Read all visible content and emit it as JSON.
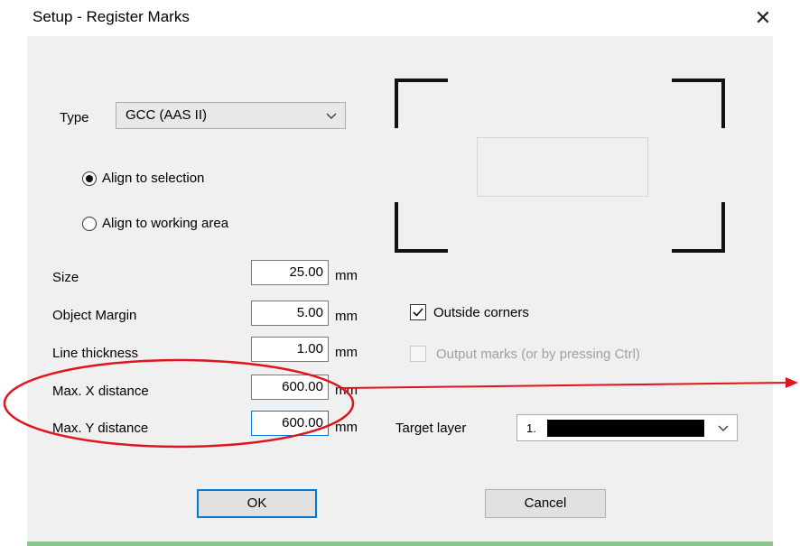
{
  "window": {
    "title": "Setup - Register Marks",
    "close_symbol": "✕"
  },
  "type_field": {
    "label": "Type",
    "value": "GCC (AAS II)"
  },
  "align": {
    "options": [
      {
        "label": "Align to selection",
        "checked": true
      },
      {
        "label": "Align to working area",
        "checked": false
      }
    ]
  },
  "fields": [
    {
      "label": "Size",
      "value": "25.00",
      "unit": "mm"
    },
    {
      "label": "Object Margin",
      "value": "5.00",
      "unit": "mm"
    },
    {
      "label": "Line thickness",
      "value": "1.00",
      "unit": "mm"
    },
    {
      "label": "Max. X distance",
      "value": "600.00",
      "unit": "mm"
    },
    {
      "label": "Max. Y distance",
      "value": "600.00",
      "unit": "mm"
    }
  ],
  "options": {
    "outside_corners": {
      "label": "Outside corners",
      "checked": true,
      "enabled": true
    },
    "output_marks": {
      "label": "Output marks (or by pressing Ctrl)",
      "checked": false,
      "enabled": false
    }
  },
  "target_layer": {
    "label": "Target layer",
    "value_prefix": "1."
  },
  "buttons": {
    "ok": "OK",
    "cancel": "Cancel"
  },
  "colors": {
    "accent": "#0078d7",
    "annotation": "#e0141e",
    "dialog_bg": "#f0f0f0",
    "disabled_text": "#a0a0a0"
  },
  "icons": [
    "close-icon",
    "chevron-down-icon",
    "checkmark-icon"
  ]
}
